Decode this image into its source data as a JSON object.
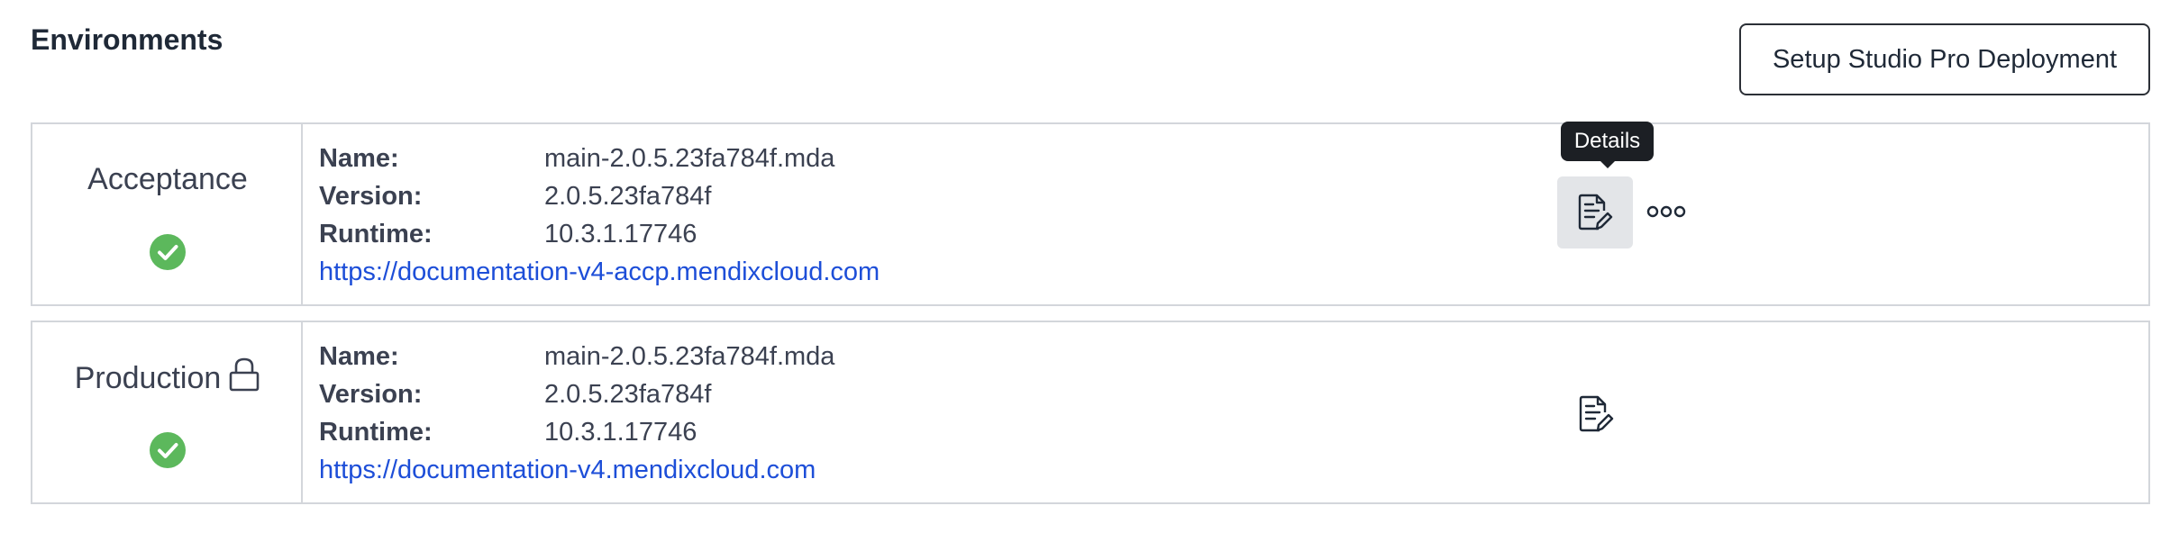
{
  "header": {
    "title": "Environments",
    "setup_button_label": "Setup Studio Pro Deployment"
  },
  "labels": {
    "name": "Name:",
    "version": "Version:",
    "runtime": "Runtime:"
  },
  "tooltip": {
    "details": "Details"
  },
  "environments": [
    {
      "name": "Acceptance",
      "locked": false,
      "status": "success",
      "package_name": "main-2.0.5.23fa784f.mda",
      "version": "2.0.5.23fa784f",
      "runtime": "10.3.1.17746",
      "url": "https://documentation-v4-accp.mendixcloud.com",
      "actions": [
        "details-icon",
        "more-options-icon"
      ]
    },
    {
      "name": "Production",
      "locked": true,
      "status": "success",
      "package_name": "main-2.0.5.23fa784f.mda",
      "version": "2.0.5.23fa784f",
      "runtime": "10.3.1.17746",
      "url": "https://documentation-v4.mendixcloud.com",
      "actions": [
        "details-icon"
      ]
    }
  ],
  "colors": {
    "success": "#5cb85c",
    "link": "#1d4ed8",
    "border": "#d3d6db",
    "tooltip_bg": "#1c1f24",
    "hover_bg": "#e3e5e8"
  }
}
